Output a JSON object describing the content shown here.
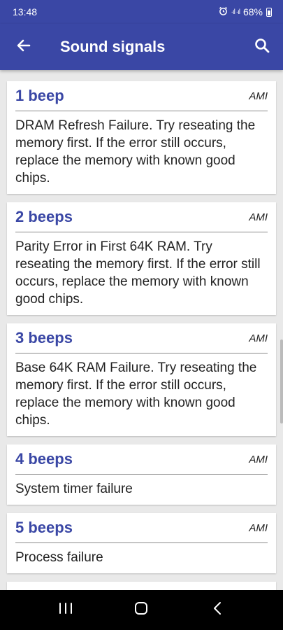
{
  "status_bar": {
    "time": "13:48",
    "signal": "·ıl ·ıl",
    "battery": "68%"
  },
  "app_bar": {
    "title": "Sound signals",
    "back_icon": "arrow-left-icon",
    "search_icon": "search-icon"
  },
  "colors": {
    "primary": "#3a47a5",
    "background": "#e9e9e9"
  },
  "signals": [
    {
      "beeps": "1 beep",
      "source": "AMI",
      "description": "DRAM Refresh Failure. Try reseating the memory first. If the error still occurs, replace the memory with known good chips."
    },
    {
      "beeps": "2 beeps",
      "source": "AMI",
      "description": "Parity Error in First 64K RAM. Try reseating the memory first. If the error still occurs, replace the memory with known good chips."
    },
    {
      "beeps": "3 beeps",
      "source": "AMI",
      "description": "Base 64K RAM Failure. Try reseating the memory first. If the error still occurs, replace the memory with known good chips."
    },
    {
      "beeps": "4 beeps",
      "source": "AMI",
      "description": "System timer failure"
    },
    {
      "beeps": "5 beeps",
      "source": "AMI",
      "description": "Process failure"
    }
  ],
  "nav_bar": {
    "recents_icon": "recents-icon",
    "home_icon": "home-icon",
    "back_icon": "back-chevron-icon"
  }
}
